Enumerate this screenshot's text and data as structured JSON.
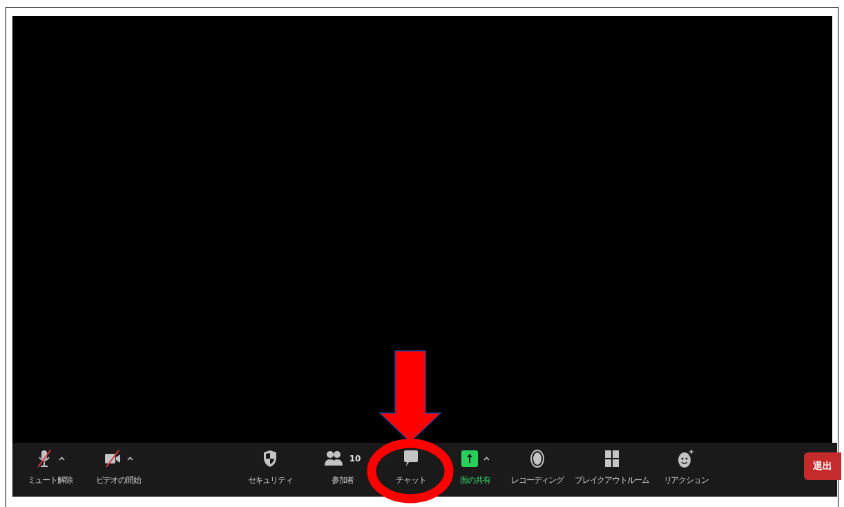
{
  "toolbar": {
    "items": [
      {
        "kind": "mic",
        "label": "ミュート解除",
        "off": true,
        "menu": true
      },
      {
        "kind": "video",
        "label": "ビデオの開始",
        "off": true,
        "menu": true
      },
      {
        "kind": "security",
        "label": "セキュリティ",
        "menu": false
      },
      {
        "kind": "participants",
        "label": "参加者",
        "count": "10",
        "menu": false
      },
      {
        "kind": "chat",
        "label": "チャット",
        "menu": false
      },
      {
        "kind": "share",
        "label": "面の共有",
        "menu": true
      },
      {
        "kind": "record",
        "label": "レコーディング",
        "menu": false
      },
      {
        "kind": "breakout",
        "label": "ブレイクアウトルーム",
        "menu": false
      },
      {
        "kind": "reaction",
        "label": "リアクション",
        "menu": false
      }
    ],
    "leave_button": "退出"
  }
}
